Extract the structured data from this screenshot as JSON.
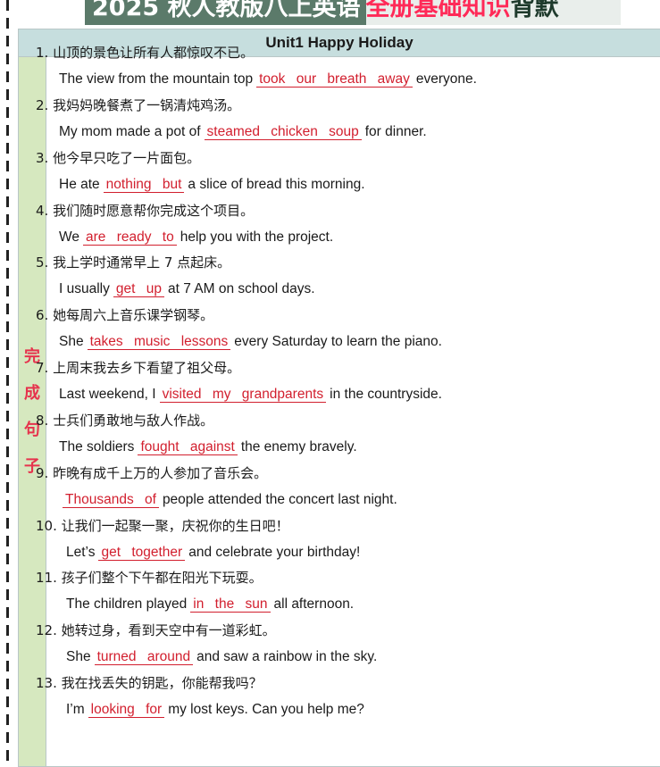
{
  "page": {
    "title_part1": "2025 秋人教版八上英语",
    "title_part2": "全册基础知识",
    "title_part3": "背默",
    "unit_header": "Unit1 Happy Holiday",
    "side_label": [
      "完",
      "成",
      "句",
      "子"
    ]
  },
  "items": [
    {
      "num": "1.",
      "zh": "山顶的景色让所有人都惊叹不已。",
      "before": "The view from the mountain top",
      "answer": "took our breath away",
      "after": "everyone."
    },
    {
      "num": "2.",
      "zh": "我妈妈晚餐煮了一锅清炖鸡汤。",
      "before": "My mom made a pot of",
      "answer": "steamed chicken soup",
      "after": "for dinner."
    },
    {
      "num": "3.",
      "zh": "他今早只吃了一片面包。",
      "before": "He ate",
      "answer": "nothing but",
      "after": "a slice of bread this morning."
    },
    {
      "num": "4.",
      "zh": "我们随时愿意帮你完成这个项目。",
      "before": "We",
      "answer": "are ready to",
      "after": "help you with the project."
    },
    {
      "num": "5.",
      "zh": "我上学时通常早上 7 点起床。",
      "before": "I usually",
      "answer": "get up",
      "after": "at 7 AM on school days."
    },
    {
      "num": "6.",
      "zh": "她每周六上音乐课学钢琴。",
      "before": "She",
      "answer": "takes music lessons",
      "after": "every Saturday to learn the piano."
    },
    {
      "num": "7.",
      "zh": "上周末我去乡下看望了祖父母。",
      "before": "Last weekend, I",
      "answer": "visited my grandparents",
      "after": "in the countryside."
    },
    {
      "num": "8.",
      "zh": "士兵们勇敢地与敌人作战。",
      "before": "The soldiers",
      "answer": "fought against",
      "after": "the enemy bravely."
    },
    {
      "num": "9.",
      "zh": "昨晚有成千上万的人参加了音乐会。",
      "before": "",
      "answer": "Thousands of",
      "after": "people attended the concert last night."
    },
    {
      "num": "10.",
      "zh": "让我们一起聚一聚，庆祝你的生日吧！",
      "before": "Let’s",
      "answer": "get together",
      "after": "and celebrate your birthday!"
    },
    {
      "num": "11.",
      "zh": "孩子们整个下午都在阳光下玩耍。",
      "before": "The children played",
      "answer": "in the sun",
      "after": "all afternoon."
    },
    {
      "num": "12.",
      "zh": "她转过身，看到天空中有一道彩虹。",
      "before": "She",
      "answer": "turned around",
      "after": "and saw a rainbow in the sky."
    },
    {
      "num": "13.",
      "zh": "我在找丢失的钥匙，你能帮我吗？",
      "before": "I’m",
      "answer": "looking for",
      "after": "my lost keys. Can you help me?"
    }
  ],
  "colors": {
    "answer_red": "#d21f2e",
    "header_teal": "#c6dede",
    "side_green": "#d6e8bf",
    "title_pink": "#ff2a58"
  }
}
